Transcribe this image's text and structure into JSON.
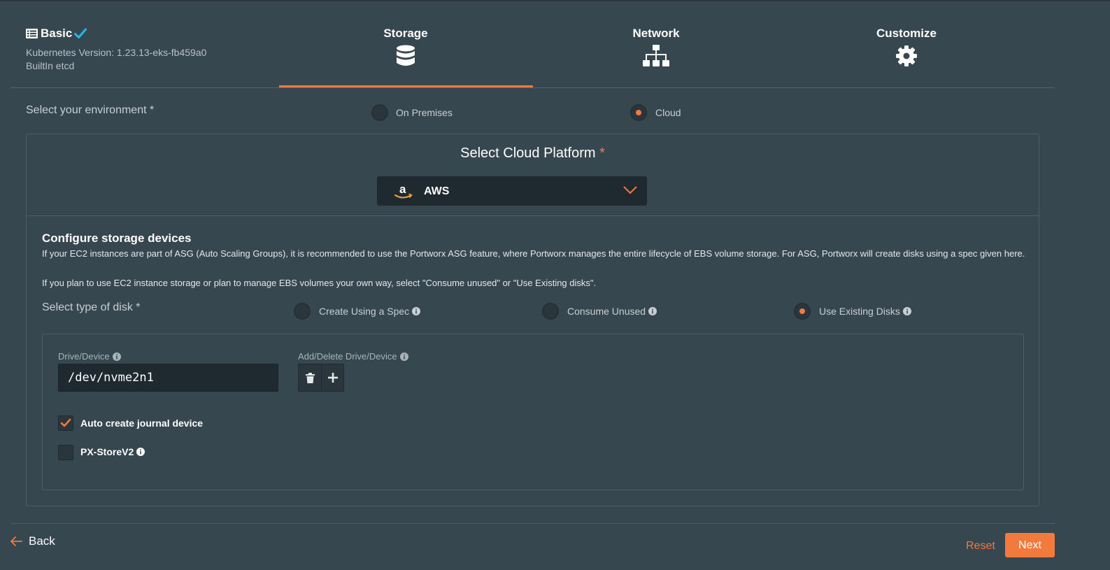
{
  "steps": {
    "basic": {
      "title": "Basic",
      "kubernetes_version": "Kubernetes Version: 1.23.13-eks-fb459a0",
      "etcd": "BuiltIn etcd",
      "icons": [
        "list-icon",
        "check-icon"
      ]
    },
    "storage": {
      "label": "Storage",
      "icon": "database-icon",
      "active": true
    },
    "network": {
      "label": "Network",
      "icon": "sitemap-icon"
    },
    "customize": {
      "label": "Customize",
      "icon": "gear-icon"
    }
  },
  "environment": {
    "label": "Select your environment *",
    "options": [
      "On Premises",
      "Cloud"
    ],
    "selected": "Cloud"
  },
  "cloud": {
    "title": "Select Cloud Platform",
    "required_mark": "*",
    "platform": {
      "value": "AWS",
      "icon": "amazon-logo-icon"
    }
  },
  "configure": {
    "title": "Configure storage devices",
    "desc1": "If your EC2 instances are part of ASG (Auto Scaling Groups), it is recommended to use the Portworx ASG feature, where Portworx manages the entire lifecycle of EBS volume storage. For ASG, Portworx will create disks using a spec given here.",
    "desc2": "If you plan to use EC2 instance storage or plan to manage EBS volumes your own way, select \"Consume unused\" or \"Use Existing disks\".",
    "disk_type_label": "Select type of disk *",
    "disk_types": [
      "Create Using a Spec",
      "Consume Unused",
      "Use Existing Disks"
    ],
    "disk_type_selected": "Use Existing Disks"
  },
  "drive": {
    "label": "Drive/Device",
    "value": "/dev/nvme2n1",
    "add_delete_label": "Add/Delete Drive/Device"
  },
  "options": {
    "auto_journal": {
      "label": "Auto create journal device",
      "checked": true
    },
    "px_storev2": {
      "label": "PX-StoreV2",
      "checked": false
    }
  },
  "footer": {
    "back": "Back",
    "reset": "Reset",
    "next": "Next"
  },
  "colors": {
    "background": "#37474f",
    "accent": "#f27a3d",
    "check_blue": "#29b6f6",
    "input_bg": "#1f2a30"
  }
}
